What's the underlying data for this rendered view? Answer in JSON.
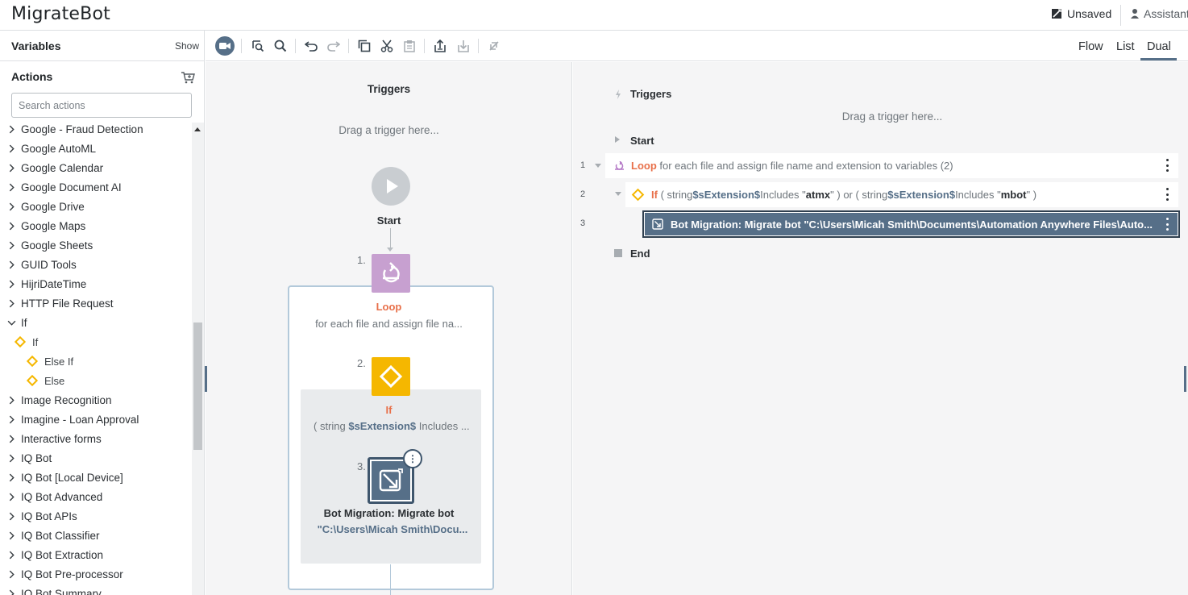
{
  "app": {
    "title": "MigrateBot",
    "status": "Unsaved",
    "assistant": "Assistant"
  },
  "sidebar": {
    "variables_title": "Variables",
    "variables_toggle": "Show",
    "actions_title": "Actions",
    "search_placeholder": "Search actions",
    "items": [
      {
        "label": "Google - Fraud Detection",
        "level": 0,
        "expanded": false
      },
      {
        "label": "Google AutoML",
        "level": 0,
        "expanded": false
      },
      {
        "label": "Google Calendar",
        "level": 0,
        "expanded": false
      },
      {
        "label": "Google Document AI",
        "level": 0,
        "expanded": false
      },
      {
        "label": "Google Drive",
        "level": 0,
        "expanded": false
      },
      {
        "label": "Google Maps",
        "level": 0,
        "expanded": false
      },
      {
        "label": "Google Sheets",
        "level": 0,
        "expanded": false
      },
      {
        "label": "GUID Tools",
        "level": 0,
        "expanded": false
      },
      {
        "label": "HijriDateTime",
        "level": 0,
        "expanded": false
      },
      {
        "label": "HTTP File Request",
        "level": 0,
        "expanded": false
      },
      {
        "label": "If",
        "level": 0,
        "expanded": true
      },
      {
        "label": "If",
        "level": 1,
        "icon": "diamond-icon"
      },
      {
        "label": "Else If",
        "level": 2,
        "icon": "diamond-icon"
      },
      {
        "label": "Else",
        "level": 2,
        "icon": "diamond-icon"
      },
      {
        "label": "Image Recognition",
        "level": 0,
        "expanded": false
      },
      {
        "label": "Imagine - Loan Approval",
        "level": 0,
        "expanded": false
      },
      {
        "label": "Interactive forms",
        "level": 0,
        "expanded": false
      },
      {
        "label": "IQ Bot",
        "level": 0,
        "expanded": false
      },
      {
        "label": "IQ Bot [Local Device]",
        "level": 0,
        "expanded": false
      },
      {
        "label": "IQ Bot Advanced",
        "level": 0,
        "expanded": false
      },
      {
        "label": "IQ Bot APIs",
        "level": 0,
        "expanded": false
      },
      {
        "label": "IQ Bot Classifier",
        "level": 0,
        "expanded": false
      },
      {
        "label": "IQ Bot Extraction",
        "level": 0,
        "expanded": false
      },
      {
        "label": "IQ Bot Pre-processor",
        "level": 0,
        "expanded": false
      },
      {
        "label": "IQ Bot Summary",
        "level": 0,
        "expanded": false
      }
    ]
  },
  "toolbar": {
    "buttons": [
      "record-icon",
      "preview-icon",
      "search-icon",
      "undo-icon",
      "redo-icon",
      "copy-icon",
      "cut-icon",
      "paste-icon",
      "export-icon",
      "import-icon",
      "disable-icon"
    ],
    "views": [
      "Flow",
      "List",
      "Dual"
    ],
    "active_view": "Dual"
  },
  "flow": {
    "triggers": "Triggers",
    "drag_trigger": "Drag a trigger here...",
    "start": "Start",
    "steps": [
      {
        "num": "1.",
        "title": "Loop",
        "desc": "for each file and assign file na..."
      },
      {
        "num": "2.",
        "title": "If",
        "desc_prefix": "( string ",
        "desc_var": "$sExtension$",
        "desc_suffix": " Includes ..."
      },
      {
        "num": "3.",
        "title": "Bot Migration: Migrate bot",
        "desc": "\"C:\\Users\\Micah Smith\\Docu..."
      }
    ]
  },
  "list": {
    "triggers": "Triggers",
    "drag_trigger": "Drag a trigger here...",
    "start": "Start",
    "end": "End",
    "rows": [
      {
        "line": "1",
        "keyword": "Loop",
        "text": "for each file and assign file name and extension to variables (2)"
      },
      {
        "line": "2",
        "keyword": "If",
        "p1": "( string ",
        "v1": "$sExtension$",
        "p2": " Includes \"",
        "s1": "atmx",
        "p3": "\" ) or ( string ",
        "v2": "$sExtension$",
        "p4": " Includes \"",
        "s2": "mbot",
        "p5": "\" )"
      },
      {
        "line": "3",
        "text": "Bot Migration: Migrate bot \"C:\\Users\\Micah Smith\\Documents\\Automation Anywhere Files\\Auto..."
      }
    ]
  },
  "colors": {
    "accent": "#566f88",
    "loop": "#c7a0d0",
    "if": "#f5b700",
    "keyword": "#e8704a"
  }
}
